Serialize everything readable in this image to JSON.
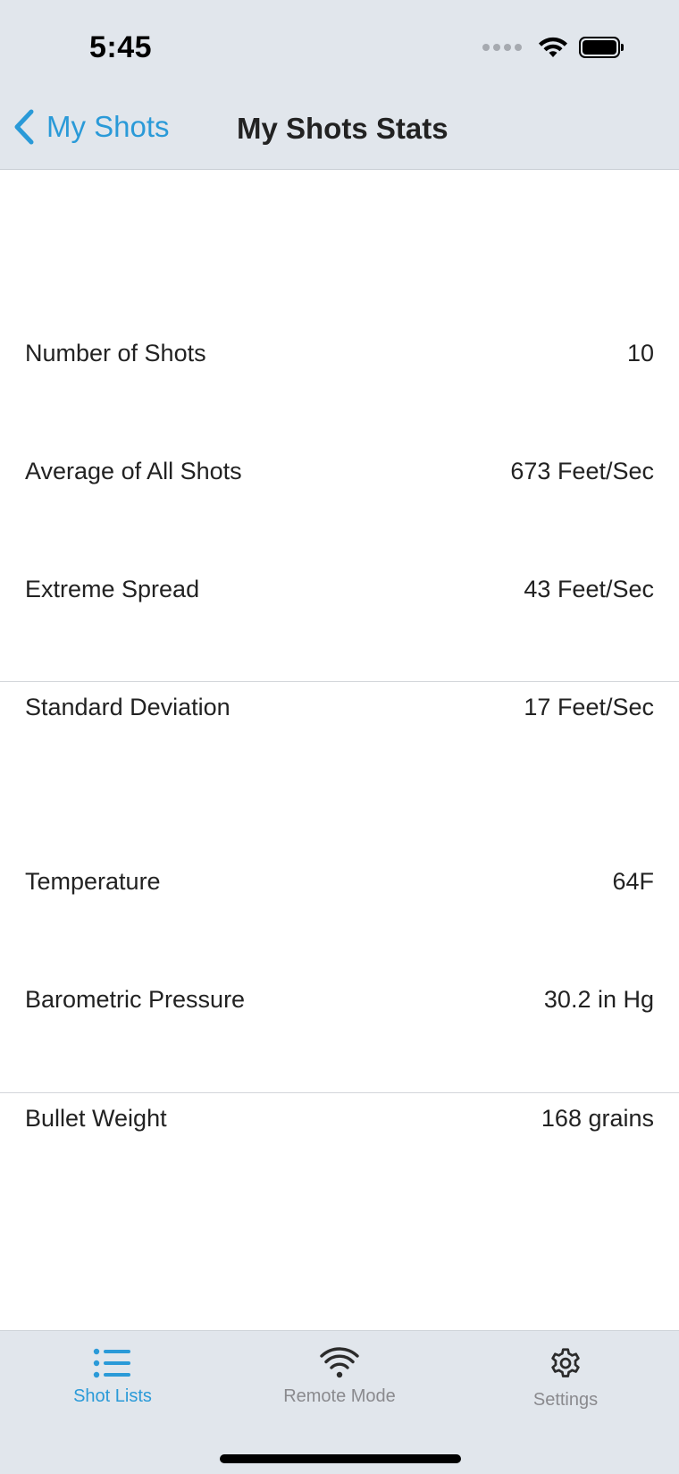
{
  "status_bar": {
    "time": "5:45"
  },
  "nav": {
    "back_label": "My Shots",
    "title": "My Shots Stats"
  },
  "stats": [
    {
      "label": "Number of Shots",
      "value": "10"
    },
    {
      "label": "Average of All Shots",
      "value": "673 Feet/Sec"
    },
    {
      "label": "Extreme Spread",
      "value": "43 Feet/Sec"
    },
    {
      "label": "Standard Deviation",
      "value": "17 Feet/Sec"
    },
    {
      "label": "Temperature",
      "value": "64F"
    },
    {
      "label": "Barometric Pressure",
      "value": "30.2 in Hg"
    },
    {
      "label": "Bullet Weight",
      "value": "168 grains"
    }
  ],
  "tabbar": {
    "tabs": [
      {
        "label": "Shot Lists",
        "icon": "list-icon",
        "active": true
      },
      {
        "label": "Remote Mode",
        "icon": "wifi-icon",
        "active": false
      },
      {
        "label": "Settings",
        "icon": "gear-icon",
        "active": false
      }
    ]
  },
  "colors": {
    "accent": "#2a9ad8",
    "chrome_background": "#e1e6ec",
    "inactive_tab": "#8a8a8e"
  }
}
